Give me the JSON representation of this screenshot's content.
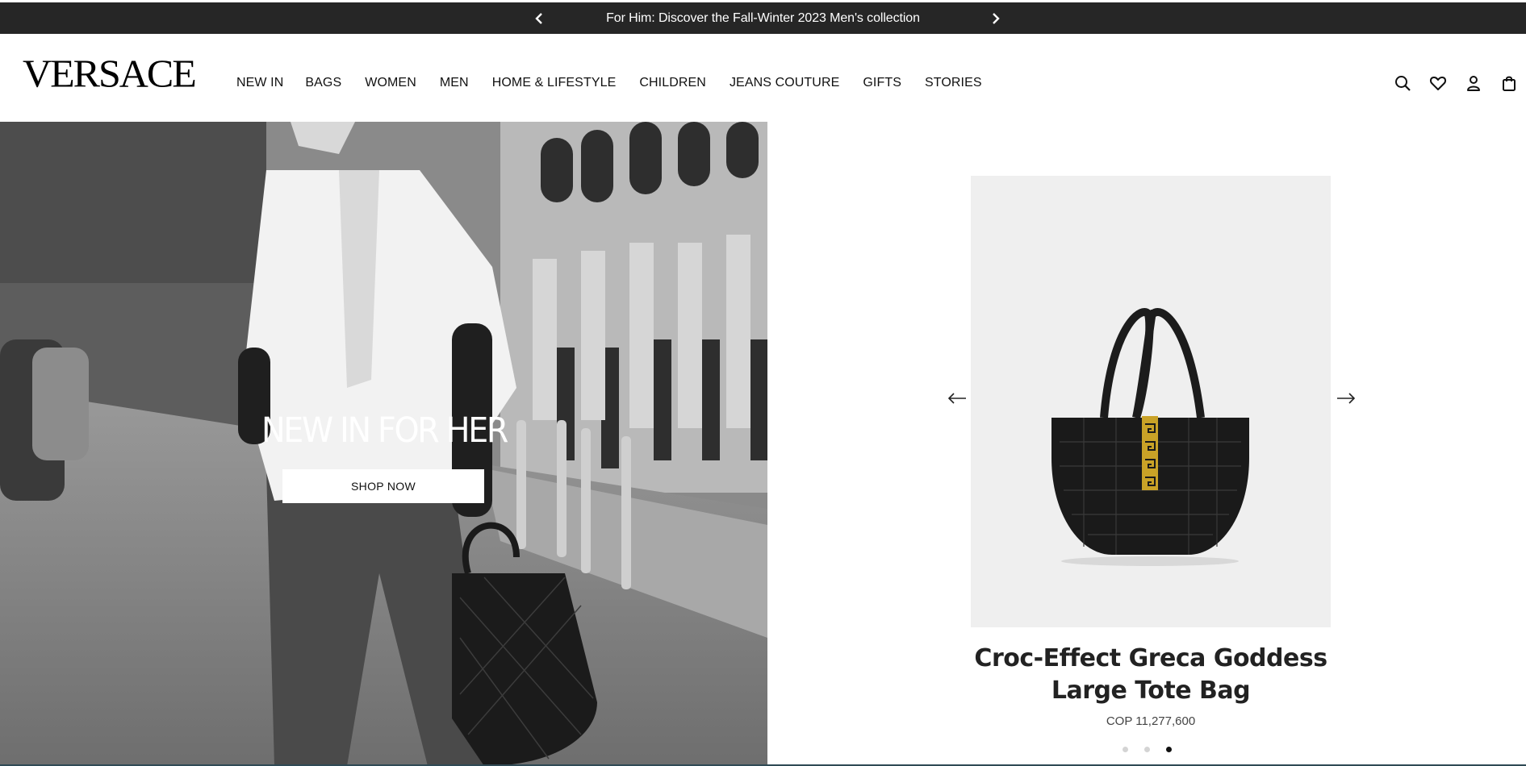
{
  "announcement": {
    "message": "For Him: Discover the Fall-Winter 2023 Men's collection",
    "prev_icon": "chevron-left-icon",
    "next_icon": "chevron-right-icon"
  },
  "header": {
    "logo": "VERSACE",
    "nav": [
      {
        "label": "NEW IN"
      },
      {
        "label": "BAGS"
      },
      {
        "label": "WOMEN"
      },
      {
        "label": "MEN"
      },
      {
        "label": "HOME & LIFESTYLE"
      },
      {
        "label": "CHILDREN"
      },
      {
        "label": "JEANS COUTURE"
      },
      {
        "label": "GIFTS"
      },
      {
        "label": "STORIES"
      }
    ],
    "icons": [
      "search-icon",
      "heart-icon",
      "user-icon",
      "bag-icon"
    ]
  },
  "hero": {
    "title": "NEW IN FOR HER",
    "cta": "SHOP NOW"
  },
  "product": {
    "name_line1": "Croc-Effect Greca Goddess",
    "name_line2": "Large Tote Bag",
    "price": "COP 11,277,600",
    "active_slide": 3,
    "total_slides": 3
  },
  "colors": {
    "announcement_bg": "#262626",
    "text_dark": "#111111",
    "product_bg": "#efefef",
    "accent_gold": "#c9a227"
  }
}
